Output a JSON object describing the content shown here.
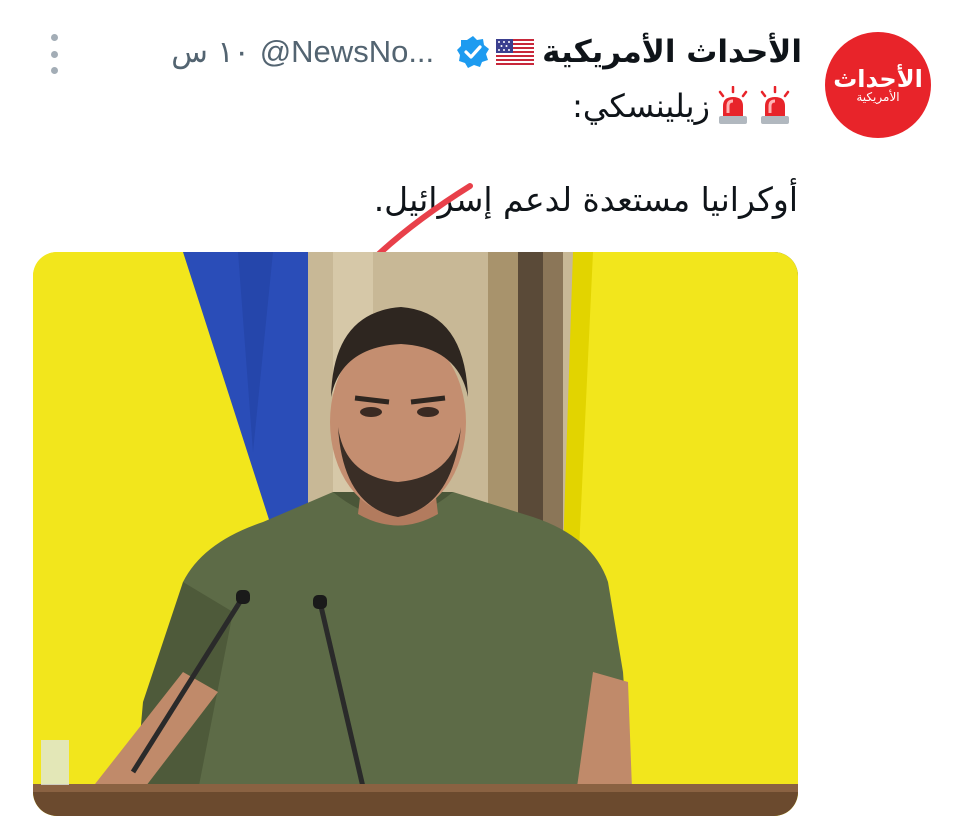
{
  "account": {
    "display_name": "الأحداث الأمريكية",
    "handle": "@NewsNo...",
    "time": "١٠ س",
    "avatar_logo_text": "الأحداث",
    "avatar_logo_subtext": "الأمريكية",
    "flag_icon": "us-flag-icon",
    "verified_icon": "verified-badge-icon"
  },
  "tweet": {
    "line1": "زيلينسكي:",
    "line1_icons": [
      "police-light-icon",
      "police-light-icon"
    ],
    "line2": "أوكرانيا مستعدة لدعم إسرائيل."
  },
  "media": {
    "description_icon": "photo"
  },
  "colors": {
    "avatar_bg": "#e8242a",
    "verified": "#1d9bf0",
    "text": "#0f1419",
    "secondary": "#536471",
    "strike": "#e8404a",
    "flag_yellow": "#f1e71b",
    "flag_blue": "#2747b6"
  }
}
